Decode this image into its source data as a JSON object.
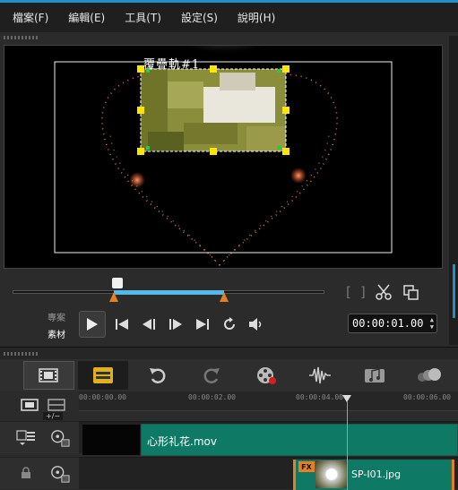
{
  "menu": {
    "items": [
      "檔案(F)",
      "編輯(E)",
      "工具(T)",
      "設定(S)",
      "說明(H)"
    ]
  },
  "preview": {
    "overlay_title": "覆疊軌#1"
  },
  "modes": {
    "project": "專案",
    "clip": "素材"
  },
  "playback": {
    "timecode": "00:00:01.00"
  },
  "timeline": {
    "ruler_ticks": [
      "00:00:00.00",
      "00:00:02.00",
      "00:00:04.00",
      "00:00:06.00"
    ],
    "zoom_label": "+/−",
    "clips": {
      "video": "心形礼花.mov",
      "overlay": "SP-I01.jpg",
      "fx": "FX"
    }
  },
  "colors": {
    "accent": "#1f8fc8",
    "clip_teal": "#0e7a66",
    "trim_orange": "#e67e22",
    "handle_yellow": "#ffe600"
  }
}
